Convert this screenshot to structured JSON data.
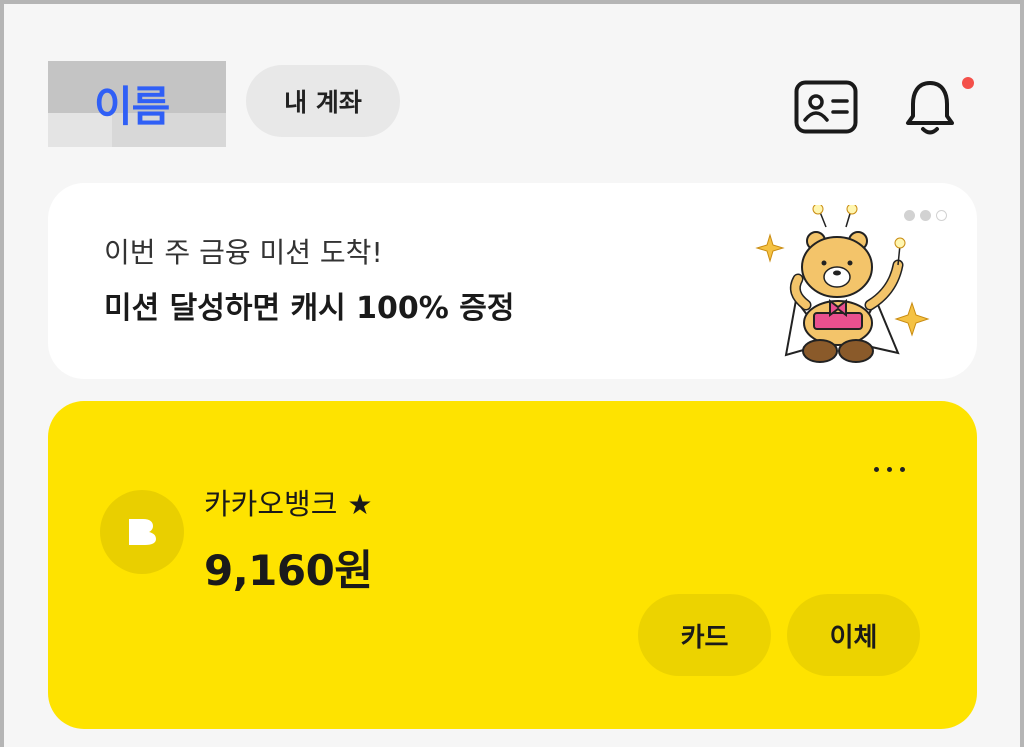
{
  "header": {
    "name_label": "이름",
    "account_pill_label": "내 계좌",
    "id_card_icon": "id-card-icon",
    "bell_icon": "bell-icon",
    "has_notification": true
  },
  "promo": {
    "line1": "이번 주 금융 미션 도착!",
    "line2": "미션 달성하면 캐시 100% 증정",
    "carousel_total": 3,
    "carousel_active": 1,
    "illustration": "celebrating-bear-character"
  },
  "account_card": {
    "bank_name": "카카오뱅크",
    "favorite_icon": "★",
    "balance": "9,160원",
    "logo_letter": "B",
    "more_icon": "more-horizontal-icon",
    "buttons": {
      "card": "카드",
      "transfer": "이체"
    }
  },
  "colors": {
    "background": "#f6f6f6",
    "name_text": "#2f5ff6",
    "card_yellow": "#fee300",
    "notification_dot": "#f4504a"
  }
}
